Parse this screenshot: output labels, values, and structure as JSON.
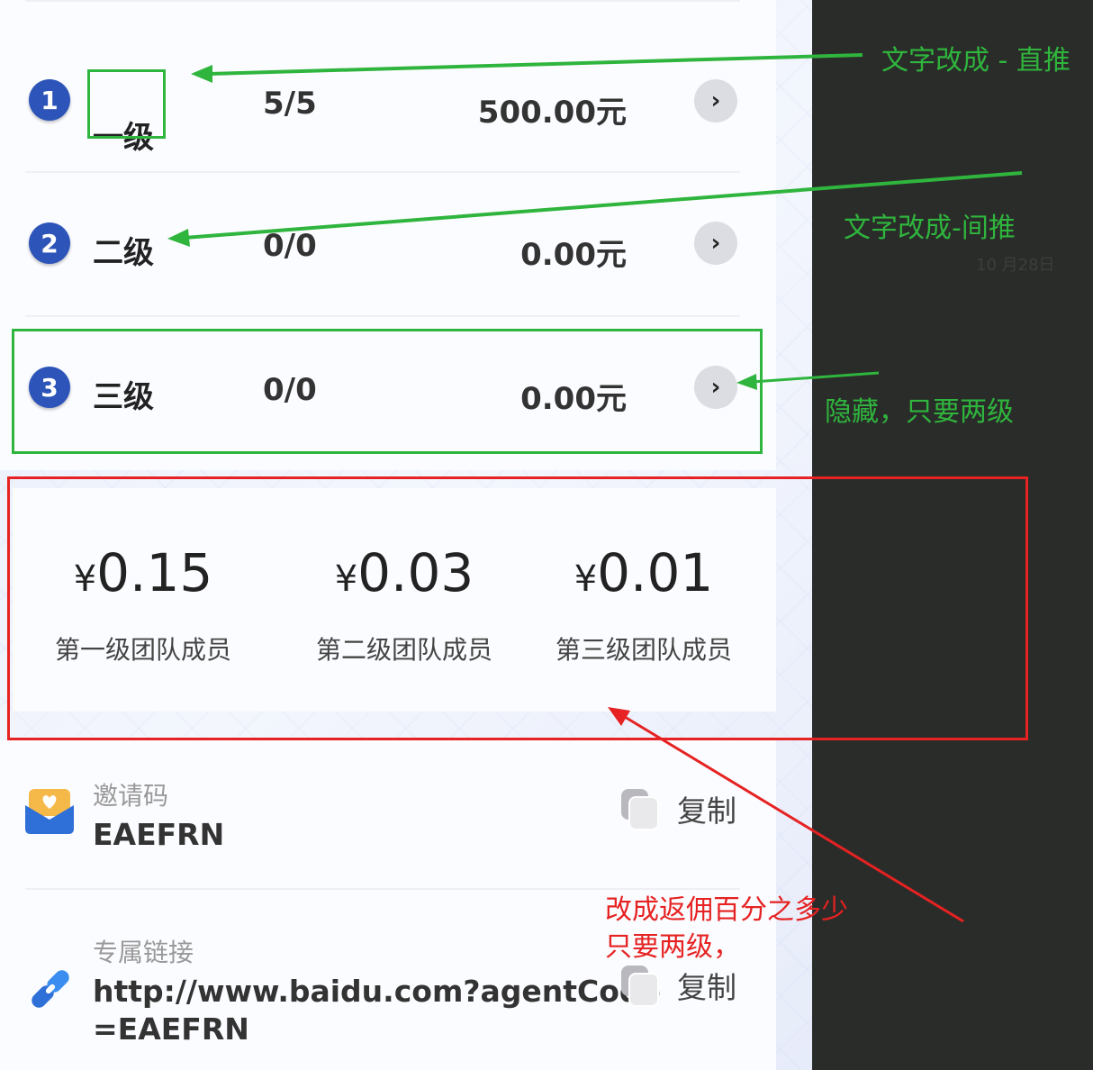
{
  "levels": [
    {
      "badge": "1",
      "label": "一级",
      "count": "5/5",
      "amount": "500.00元"
    },
    {
      "badge": "2",
      "label": "二级",
      "count": "0/0",
      "amount": "0.00元"
    },
    {
      "badge": "3",
      "label": "三级",
      "count": "0/0",
      "amount": "0.00元"
    }
  ],
  "chevron": "›",
  "stats": [
    {
      "currency": "¥",
      "value": "0.15",
      "label": "第一级团队成员"
    },
    {
      "currency": "¥",
      "value": "0.03",
      "label": "第二级团队成员"
    },
    {
      "currency": "¥",
      "value": "0.01",
      "label": "第三级团队成员"
    }
  ],
  "invite": {
    "label": "邀请码",
    "value": "EAEFRN",
    "copy_label": "复制"
  },
  "link": {
    "label": "专属链接",
    "value_line1": "http://www.baidu.com?agentCode",
    "value_line2": "=EAEFRN",
    "copy_label": "复制"
  },
  "annotations": {
    "level1": "文字改成 - 直推",
    "level2": "文字改成-间推",
    "level3": "隐藏，只要两级",
    "stats_line1": "改成返佣百分之多少",
    "stats_line2": "只要两级，"
  },
  "background_date": "10 月28日",
  "colors": {
    "annotation_green": "#2fb53d",
    "annotation_red": "#e62222",
    "badge_blue": "#2d54b9",
    "dark_panel": "#2a2c29"
  },
  "icons": [
    "envelope-heart-icon",
    "link-icon",
    "copy-icon",
    "chevron-right-icon"
  ]
}
